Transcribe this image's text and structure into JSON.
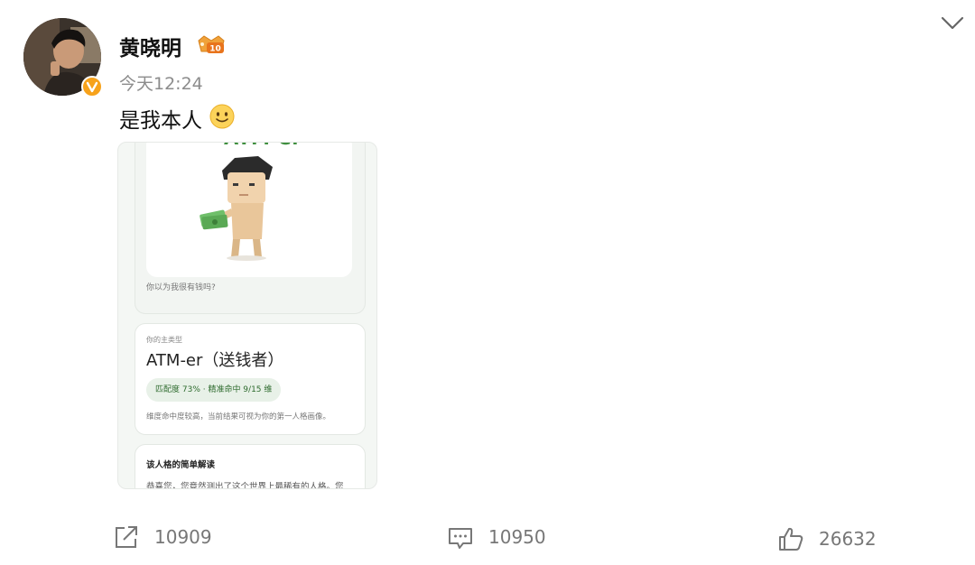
{
  "post": {
    "username": "黄晓明",
    "timestamp": "今天12:24",
    "text": "是我本人"
  },
  "image": {
    "result_title": "ATM-er",
    "caption": "你以为我很有钱吗?",
    "type_label": "你的主类型",
    "type_name": "ATM-er（送钱者）",
    "match_pill": "匹配度 73% · 精准命中 9/15 维",
    "match_desc": "维度命中度较高，当前结果可视为你的第一人格画像。",
    "interpret_title": "该人格的简单解读",
    "interpret_text": "恭喜您，您竟然测出了这个世界上最稀有的人格。您"
  },
  "actions": {
    "shares": "10909",
    "comments": "10950",
    "likes": "26632"
  },
  "colors": {
    "accent_green": "#3f8f3f",
    "verified_badge": "#f7a21b",
    "meta_gray": "#8c8c8c"
  },
  "icons": {
    "share": "share-icon",
    "comment": "comment-icon",
    "like": "thumbs-up-icon",
    "expand": "chevron-down-icon",
    "verified": "verified-v-icon",
    "level": "level-badge-icon"
  }
}
